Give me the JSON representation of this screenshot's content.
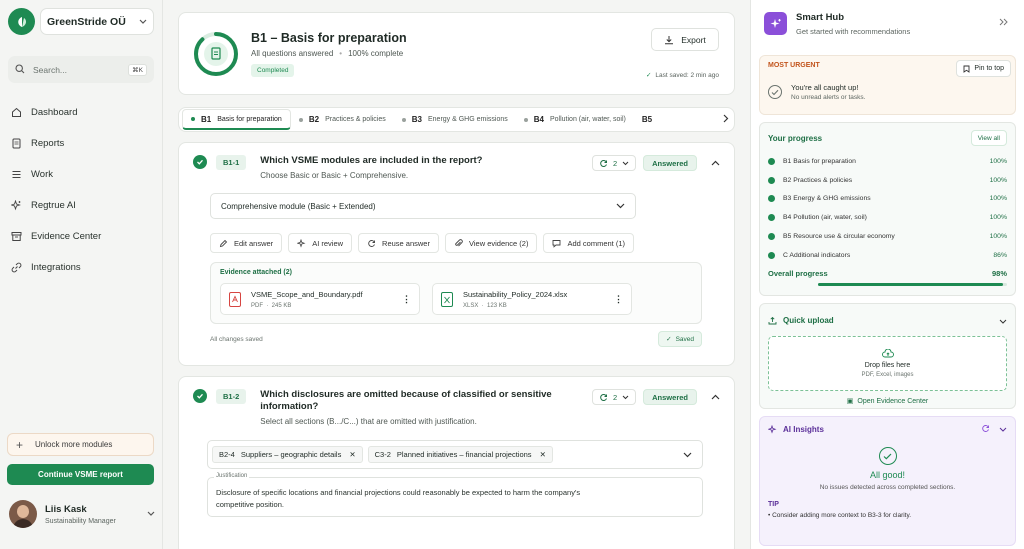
{
  "org": {
    "name": "GreenStride OÜ"
  },
  "search": {
    "placeholder": "Search...",
    "shortcut": "⌘K"
  },
  "nav": [
    {
      "label": "Dashboard",
      "icon": "home-icon"
    },
    {
      "label": "Reports",
      "icon": "document-icon"
    },
    {
      "label": "Work",
      "icon": "list-icon"
    },
    {
      "label": "Regtrue AI",
      "icon": "sparkle-icon"
    },
    {
      "label": "Evidence Center",
      "icon": "archive-icon"
    },
    {
      "label": "Integrations",
      "icon": "link-icon"
    }
  ],
  "sidebar": {
    "unlock_label": "Unlock more modules",
    "continue_label": "Continue VSME report"
  },
  "user": {
    "name": "Liis Kask",
    "role": "Sustainability Manager"
  },
  "header": {
    "title": "B1 – Basis for preparation",
    "status": "All questions answered",
    "complete": "100% complete",
    "badge": "Completed",
    "export_label": "Export",
    "last_saved": "Last saved: 2 min ago",
    "progress": 1.0
  },
  "tabs": [
    {
      "code": "B1",
      "label": "Basis for preparation"
    },
    {
      "code": "B2",
      "label": "Practices & policies"
    },
    {
      "code": "B3",
      "label": "Energy & GHG emissions"
    },
    {
      "code": "B4",
      "label": "Pollution (air, water, soil)"
    },
    {
      "code": "B5",
      "label": ""
    }
  ],
  "q1": {
    "id": "B1-1",
    "title": "Which VSME modules are included in the report?",
    "desc": "Choose Basic or Basic + Comprehensive.",
    "revisions": "2",
    "status": "Answered",
    "answer": "Comprehensive module (Basic + Extended)",
    "actions": [
      "Edit answer",
      "AI review",
      "Reuse answer",
      "View evidence (2)",
      "Add comment (1)"
    ],
    "evidence_label": "Evidence attached (2)",
    "files": [
      {
        "name": "VSME_Scope_and_Boundary.pdf",
        "type": "PDF",
        "size": "245 KB"
      },
      {
        "name": "Sustainability_Policy_2024.xlsx",
        "type": "XLSX",
        "size": "123 KB"
      }
    ],
    "changes": "All changes saved",
    "saved": "Saved"
  },
  "q2": {
    "id": "B1-2",
    "title_line1": "Which disclosures are omitted because of classified or sensitive",
    "title_line2": "information?",
    "desc": "Select all sections (B.../C...) that are omitted with justification.",
    "revisions": "2",
    "status": "Answered",
    "chips": [
      {
        "code": "B2-4",
        "label": "Suppliers – geographic details"
      },
      {
        "code": "C3-2",
        "label": "Planned initiatives – financial projections"
      }
    ],
    "justification_label": "Justification",
    "justification_line1": "Disclosure of specific locations and financial projections could reasonably be expected to harm the company's",
    "justification_line2": "competitive position."
  },
  "hub": {
    "title": "Smart Hub",
    "subtitle": "Get started with recommendations",
    "urgent_label": "MOST URGENT",
    "pin_label": "Pin to top",
    "caught_title": "You're all caught up!",
    "caught_sub": "No unread alerts or tasks.",
    "progress_title": "Your progress",
    "view_all": "View all",
    "progress_items": [
      {
        "label": "B1 Basis for preparation",
        "value": "100%"
      },
      {
        "label": "B2 Practices & policies",
        "value": "100%"
      },
      {
        "label": "B3 Energy & GHG emissions",
        "value": "100%"
      },
      {
        "label": "B4 Pollution (air, water, soil)",
        "value": "100%"
      },
      {
        "label": "B5 Resource use & circular economy",
        "value": "100%"
      },
      {
        "label": "C Additional indicators",
        "value": "86%"
      }
    ],
    "overall_label": "Overall progress",
    "overall_value": "98%",
    "overall_fraction": 0.98,
    "upload_title": "Quick upload",
    "drop_text": "Drop files here",
    "drop_types": "PDF, Excel, images",
    "open_evidence": "Open Evidence Center",
    "insights_title": "AI Insights",
    "all_good": "All good!",
    "all_good_sub": "No issues detected across completed sections.",
    "tip_label": "TIP",
    "tip_text": "• Consider adding more context to B3-3 for clarity."
  },
  "colors": {
    "brand": "#1e8a52",
    "urgent": "#c2541c",
    "ai": "#8b4fd9"
  }
}
